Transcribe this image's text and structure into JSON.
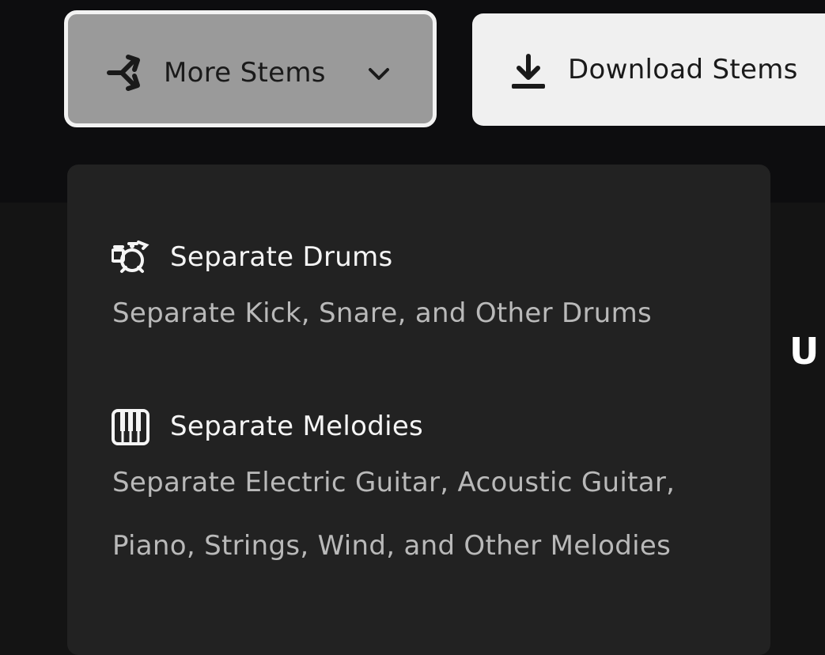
{
  "toolbar": {
    "more_stems": {
      "label": "More Stems",
      "icon": "split-arrows-icon",
      "chevron_icon": "chevron-down-icon"
    },
    "download_stems": {
      "label": "Download Stems",
      "icon": "download-icon"
    }
  },
  "dropdown": {
    "items": [
      {
        "title": "Separate Drums",
        "description": "Separate Kick, Snare, and Other Drums",
        "icon": "drum-kit-icon"
      },
      {
        "title": "Separate Melodies",
        "description": "Separate Electric Guitar, Acoustic Guitar, Piano, Strings, Wind, and Other Melodies",
        "icon": "piano-keys-icon"
      }
    ]
  },
  "background": {
    "partial_heading": "U"
  },
  "colors": {
    "page_bg": "#141414",
    "top_band_bg": "#0d0d0f",
    "more_stems_bg": "#9a9a9a",
    "download_bg": "#f0f0f0",
    "dropdown_bg": "#222222",
    "title_text": "#f5f5f5",
    "desc_text": "#b9b9b9"
  }
}
